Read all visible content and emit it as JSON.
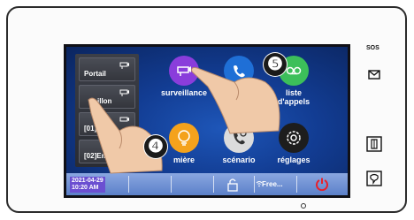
{
  "sidebar": {
    "cameras": [
      {
        "label": "Portail",
        "icon": "cctv-camera-icon"
      },
      {
        "label": "illon",
        "icon": "cctv-camera-icon"
      },
      {
        "label": "[01]",
        "icon": "cctv-camera-icon"
      },
      {
        "label": "[02]Emn",
        "icon": "cctv-camera-icon"
      }
    ]
  },
  "apps": [
    {
      "label": "surveillance",
      "icon": "cctv-camera-icon",
      "color": "#8a3ddb"
    },
    {
      "label": "intercom",
      "icon": "handset-icon",
      "color": "#1f6fd6"
    },
    {
      "label": "liste\nd'appels",
      "icon": "voicemail-icon",
      "color": "#3cbf5a"
    },
    {
      "label": "mière",
      "icon": "light-bulb-icon",
      "color": "#f4a21c"
    },
    {
      "label": "scénario",
      "icon": "phone-gear-icon",
      "color": "#dcdcdc"
    },
    {
      "label": "réglages",
      "icon": "gear-icon",
      "color": "#1d1d1d"
    }
  ],
  "status_bar": {
    "date": "2021-04-29",
    "time": "10:20 AM",
    "wifi_label": "Free...",
    "power_icon": "power-icon",
    "device_icon": "unlock-icon"
  },
  "hardware": {
    "sos_label": "SOS",
    "mail_icon": "mail-icon",
    "door_icon": "door-icon",
    "talk_icon": "chat-icon"
  },
  "callouts": {
    "step_4": "❹",
    "step_5": "❺"
  },
  "colors": {
    "screen_bg": "#123c92",
    "status_bar": "#6f90d4",
    "power_red": "#e8202a"
  }
}
